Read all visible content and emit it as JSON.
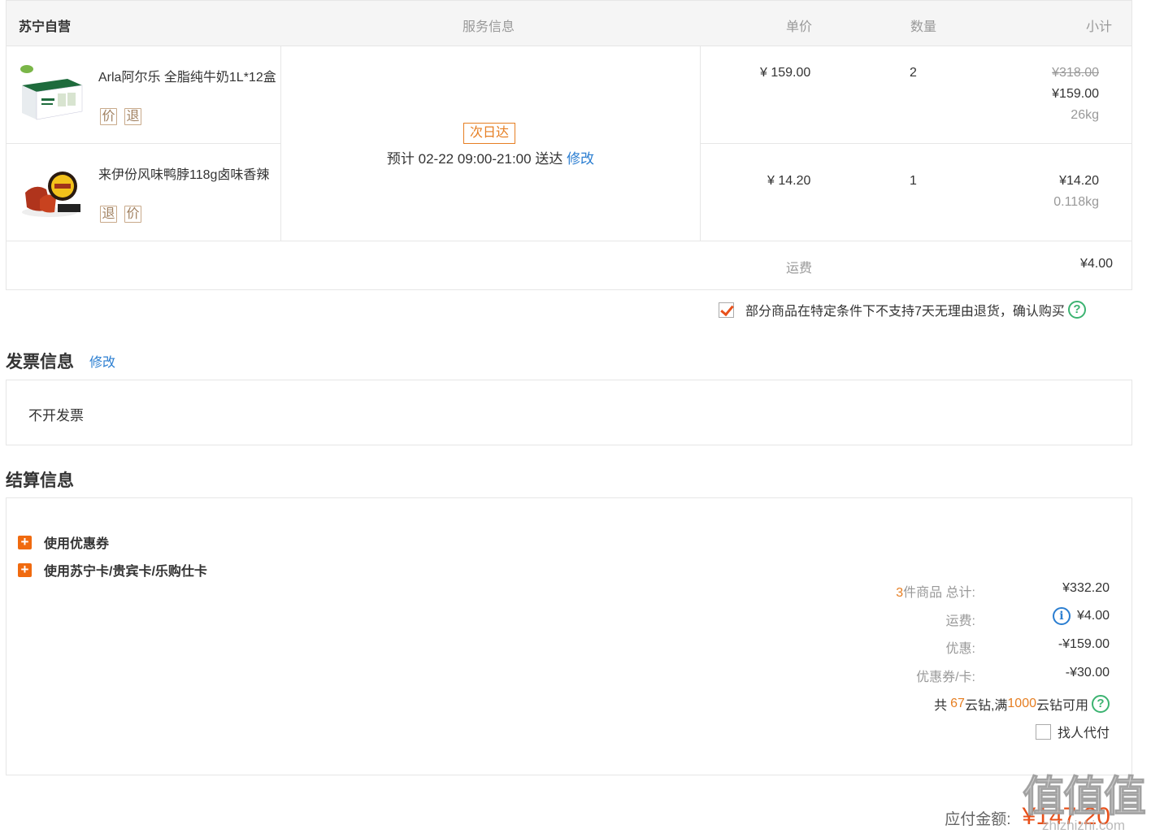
{
  "table": {
    "store": "苏宁自营",
    "col_service": "服务信息",
    "col_price": "单价",
    "col_qty": "数量",
    "col_subtotal": "小计"
  },
  "items": [
    {
      "name": "Arla阿尔乐 全脂纯牛奶1L*12盒",
      "tags": [
        "价",
        "退"
      ],
      "price": "¥ 159.00",
      "qty": "2",
      "original_subtotal": "¥318.00",
      "subtotal": "¥159.00",
      "weight": "26kg"
    },
    {
      "name": "来伊份风味鸭脖118g卤味香辣",
      "tags": [
        "退",
        "价"
      ],
      "price": "¥ 14.20",
      "qty": "1",
      "subtotal": "¥14.20",
      "weight": "0.118kg"
    }
  ],
  "service": {
    "badge": "次日达",
    "eta": "预计  02-22   09:00-21:00  送达",
    "modify": "修改"
  },
  "shipping": {
    "label": "运费",
    "value": "¥4.00"
  },
  "confirm_text": "部分商品在特定条件下不支持7天无理由退货，确认购买",
  "invoice": {
    "title": "发票信息",
    "modify": "修改",
    "value": "不开发票"
  },
  "settlement": {
    "title": "结算信息",
    "coupon": "使用优惠券",
    "card": "使用苏宁卡/贵宾卡/乐购仕卡",
    "count": "3",
    "total_label": "件商品 总计:",
    "total": "¥332.20",
    "ship_label": "运费:",
    "ship": "¥4.00",
    "discount_label": "优惠:",
    "discount": "-¥159.00",
    "coupon_label": "优惠券/卡:",
    "coupon_value": "-¥30.00",
    "diamond_pre": "共",
    "diamond_count": "67",
    "diamond_mid": "云钻,满",
    "diamond_threshold": "1000",
    "diamond_post": "云钻可用",
    "proxy_pay": "找人代付"
  },
  "payable": {
    "label": "应付金额:",
    "value": "¥147.20"
  },
  "watermark": {
    "big": "值值值",
    "small": "zhizhizhi.com"
  },
  "colors": {
    "accent": "#e8501a",
    "link": "#2b7ed1",
    "help": "#3cb371"
  }
}
